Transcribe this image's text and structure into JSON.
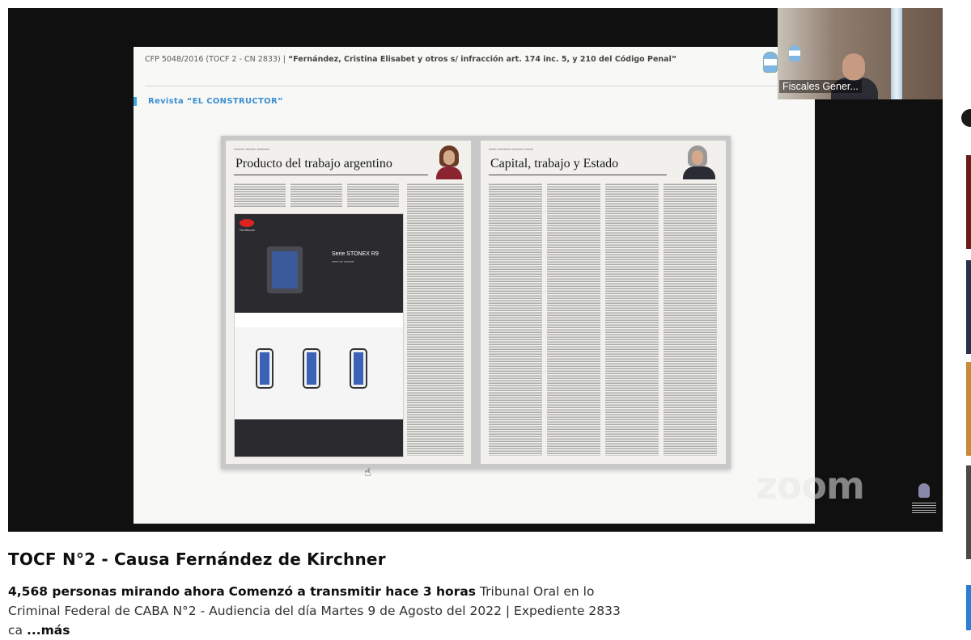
{
  "slide": {
    "header_case": "CFP 5048/2016 (TOCF 2 - CN 2833)",
    "header_caption": "“Fernández, Cristina Elisabet y otros s/ infracción art. 174 inc. 5, y 210 del Código Penal”",
    "section_tag": "Revista “EL CONSTRUCTOR”",
    "left_page_title": "Producto del trabajo argentino",
    "right_page_title": "Capital, trabajo y Estado",
    "ad_brand": "GeoBauen",
    "ad_series": "Serie STONEX R9"
  },
  "overlay": {
    "zoom_logo": "zoom",
    "participant_label": "Fiscales Gener..."
  },
  "video": {
    "title": "TOCF N°2 - Causa Fernández de Kirchner",
    "viewers": "4,568 personas mirando ahora",
    "started": "Comenzó a transmitir hace 3 horas",
    "description": "Tribunal Oral en lo Criminal Federal de CABA N°2 - Audiencia del día Martes 9 de Agosto del 2022 | Expediente 2833 ca",
    "more_label": "...más"
  },
  "colors": {
    "section_tag": "#3b8fd1",
    "video_bg": "#101010"
  },
  "icons": {
    "pointer": "hand-pointer-icon",
    "emblem": "argentina-coat-of-arms-icon"
  }
}
